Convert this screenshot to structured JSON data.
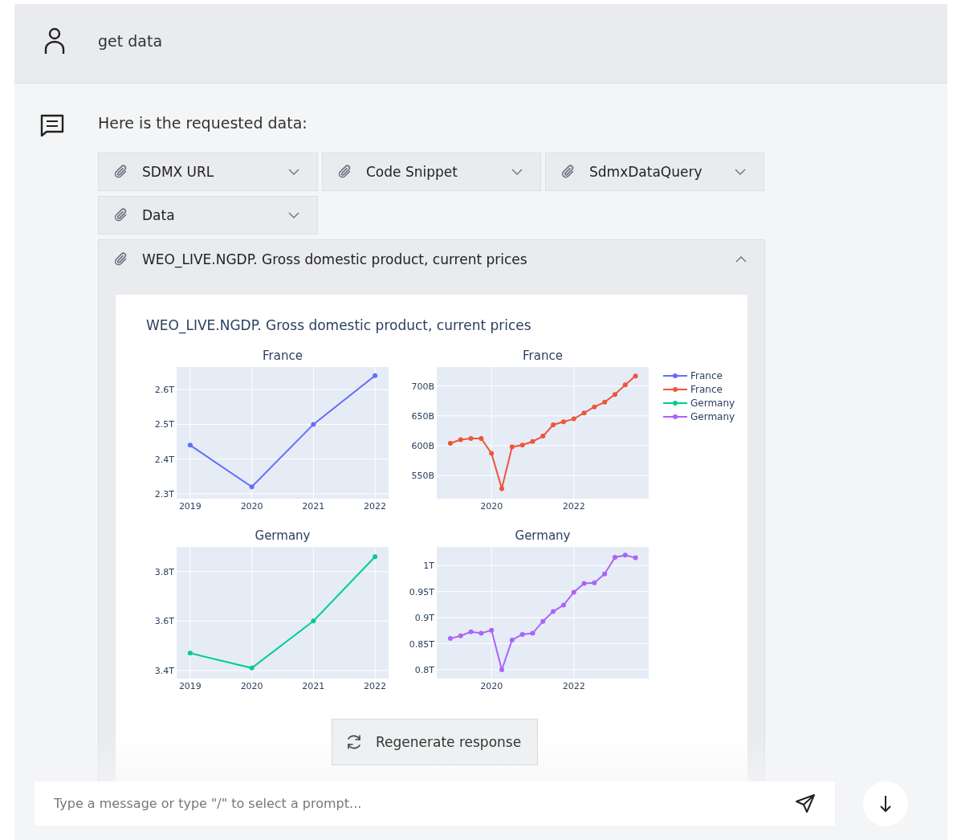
{
  "user_message": {
    "text": "get data"
  },
  "assistant_message": {
    "text": "Here is the requested data:",
    "attachments": [
      {
        "label": "SDMX URL",
        "expanded": false
      },
      {
        "label": "Code Snippet",
        "expanded": false
      },
      {
        "label": "SdmxDataQuery",
        "expanded": false
      },
      {
        "label": "Data",
        "expanded": false
      }
    ],
    "panel": {
      "label": "WEO_LIVE.NGDP. Gross domestic product, current prices",
      "expanded": true,
      "figure_title": "WEO_LIVE.NGDP. Gross domestic product, current prices",
      "charts": [
        {
          "chart_data": {
            "type": "line",
            "grid": true,
            "title": "France",
            "x": [
              2019,
              2020,
              2021,
              2022
            ],
            "xlim": [
              2018.78,
              2022.22
            ],
            "ylim": [
              2.286,
              2.665
            ],
            "xticks": [
              2019,
              2020,
              2021,
              2022
            ],
            "yticks": [
              {
                "value": 2.3,
                "label": "2.3T"
              },
              {
                "value": 2.4,
                "label": "2.4T"
              },
              {
                "value": 2.5,
                "label": "2.5T"
              },
              {
                "value": 2.6,
                "label": "2.6T"
              }
            ],
            "series": [
              {
                "name": "France",
                "color": "#636efa",
                "marker": true,
                "values": [
                  2.44,
                  2.32,
                  2.5,
                  2.64
                ]
              }
            ]
          }
        },
        {
          "chart_data": {
            "type": "line",
            "grid": true,
            "title": "France",
            "x": [
              2019,
              2019.25,
              2019.5,
              2019.75,
              2020,
              2020.25,
              2020.5,
              2020.75,
              2021,
              2021.25,
              2021.5,
              2021.75,
              2022,
              2022.25,
              2022.5,
              2022.75,
              2023,
              2023.25,
              2023.5
            ],
            "xlim": [
              2018.67,
              2023.82
            ],
            "ylim": [
              511,
              732
            ],
            "xticks": [
              2020,
              2022
            ],
            "yticks": [
              {
                "value": 550,
                "label": "550B"
              },
              {
                "value": 600,
                "label": "600B"
              },
              {
                "value": 650,
                "label": "650B"
              },
              {
                "value": 700,
                "label": "700B"
              }
            ],
            "series": [
              {
                "name": "France",
                "color": "#ef553b",
                "marker": true,
                "values": [
                  604,
                  610,
                  612,
                  612,
                  587,
                  528,
                  598,
                  601,
                  607,
                  616,
                  635,
                  640,
                  645,
                  655,
                  665,
                  673,
                  686,
                  702,
                  717
                ]
              }
            ]
          }
        },
        {
          "chart_data": {
            "type": "line",
            "grid": true,
            "title": "Germany",
            "x": [
              2019,
              2020,
              2021,
              2022
            ],
            "xlim": [
              2018.78,
              2022.22
            ],
            "ylim": [
              3.367,
              3.9
            ],
            "xticks": [
              2019,
              2020,
              2021,
              2022
            ],
            "yticks": [
              {
                "value": 3.4,
                "label": "3.4T"
              },
              {
                "value": 3.6,
                "label": "3.6T"
              },
              {
                "value": 3.8,
                "label": "3.8T"
              }
            ],
            "series": [
              {
                "name": "Germany",
                "color": "#00cc96",
                "marker": true,
                "values": [
                  3.47,
                  3.41,
                  3.6,
                  3.86
                ]
              }
            ]
          }
        },
        {
          "chart_data": {
            "type": "line",
            "grid": true,
            "title": "Germany",
            "x": [
              2019,
              2019.25,
              2019.5,
              2019.75,
              2020,
              2020.25,
              2020.5,
              2020.75,
              2021,
              2021.25,
              2021.5,
              2021.75,
              2022,
              2022.25,
              2022.5,
              2022.75,
              2023,
              2023.25,
              2023.5
            ],
            "xlim": [
              2018.67,
              2023.82
            ],
            "ylim": [
              0.783,
              1.036
            ],
            "xticks": [
              2020,
              2022
            ],
            "yticks": [
              {
                "value": 0.8,
                "label": "0.8T"
              },
              {
                "value": 0.85,
                "label": "0.85T"
              },
              {
                "value": 0.9,
                "label": "0.9T"
              },
              {
                "value": 0.95,
                "label": "0.95T"
              },
              {
                "value": 1,
                "label": "1T"
              }
            ],
            "series": [
              {
                "name": "Germany",
                "color": "#ab63fa",
                "marker": true,
                "values": [
                  0.86,
                  0.865,
                  0.873,
                  0.87,
                  0.876,
                  0.8,
                  0.857,
                  0.868,
                  0.87,
                  0.893,
                  0.912,
                  0.924,
                  0.949,
                  0.966,
                  0.967,
                  0.984,
                  1.016,
                  1.02,
                  1.015
                ]
              }
            ]
          }
        }
      ]
    }
  },
  "regenerate_button": {
    "label": "Regenerate response"
  },
  "composer": {
    "placeholder": "Type a message or type \"/\" to select a prompt..."
  }
}
